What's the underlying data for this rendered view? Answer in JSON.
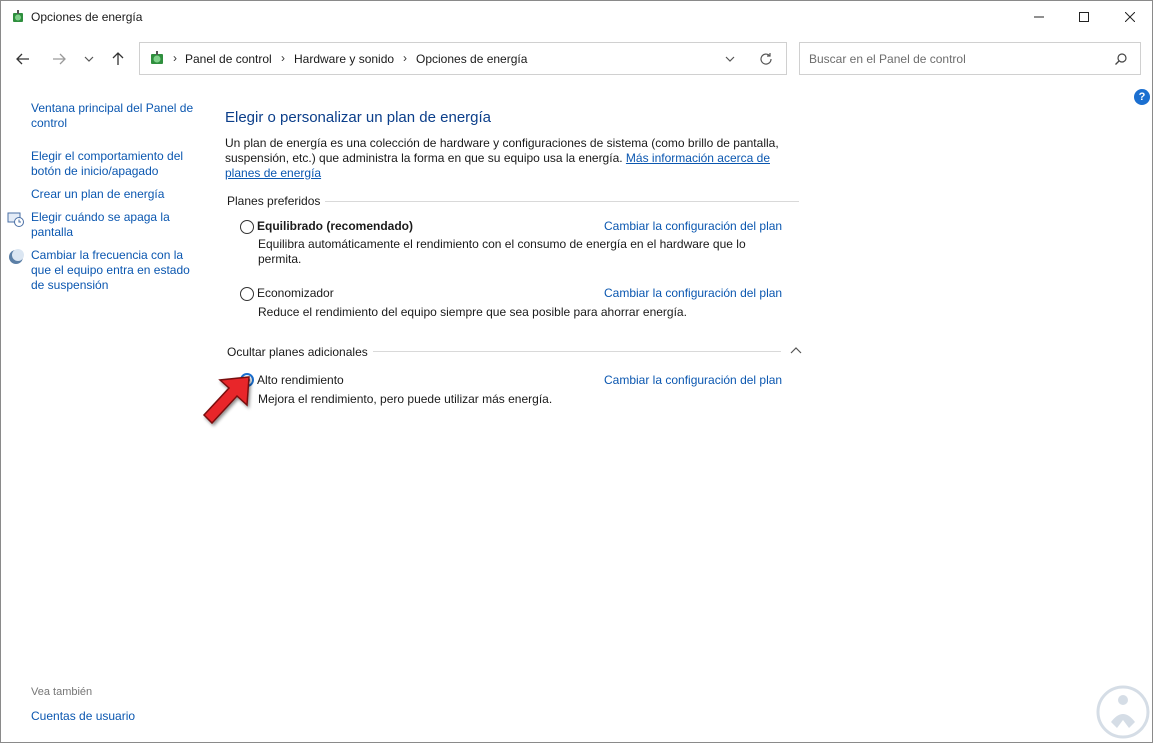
{
  "window": {
    "title": "Opciones de energía"
  },
  "address": {
    "crumbs": [
      "Panel de control",
      "Hardware y sonido",
      "Opciones de energía"
    ]
  },
  "search": {
    "placeholder": "Buscar en el Panel de control"
  },
  "help": {
    "label": "?"
  },
  "sidebar": {
    "links": [
      "Ventana principal del Panel de control",
      "Elegir el comportamiento del botón de inicio/apagado",
      "Crear un plan de energía",
      "Elegir cuándo se apaga la pantalla",
      "Cambiar la frecuencia con la que el equipo entra en estado de suspensión"
    ],
    "see_also_title": "Vea también",
    "see_also_links": [
      "Cuentas de usuario"
    ]
  },
  "main": {
    "title": "Elegir o personalizar un plan de energía",
    "description": "Un plan de energía es una colección de hardware y configuraciones de sistema (como brillo de pantalla, suspensión, etc.) que administra la forma en que su equipo usa la energía.",
    "more_info_link": "Más información acerca de planes de energía",
    "preferred_title": "Planes preferidos",
    "additional_title": "Ocultar planes adicionales",
    "change_link": "Cambiar la configuración del plan",
    "plans": [
      {
        "name": "Equilibrado (recomendado)",
        "desc": "Equilibra automáticamente el rendimiento con el consumo de energía en el hardware que lo permita.",
        "selected": false
      },
      {
        "name": "Economizador",
        "desc": "Reduce el rendimiento del equipo siempre que sea posible para ahorrar energía.",
        "selected": false
      },
      {
        "name": "Alto rendimiento",
        "desc": "Mejora el rendimiento, pero puede utilizar más energía.",
        "selected": true
      }
    ]
  },
  "colors": {
    "link": "#0b57b0",
    "title": "#0b3e8a",
    "accent": "#1b6fd0",
    "arrow": "#e8282b"
  }
}
